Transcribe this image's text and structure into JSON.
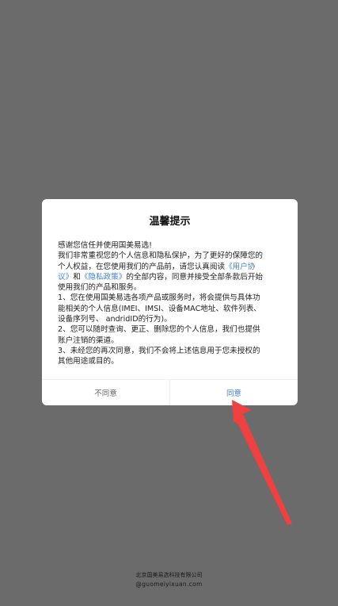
{
  "dialog": {
    "title": "温馨提示",
    "body": {
      "l1": "感谢您信任并使用国美易选!",
      "l2": "我们非常重视您的个人信息和隐私保护，为了更好的保障您的",
      "l3a": "个人权益，在您使用我们的产品前，请您认真阅读",
      "l3link": "《用户协",
      "l4link1": "议》",
      "l4b": "和",
      "l4link2": "《隐私政策》",
      "l4c": "的全部内容，同意并接受全部条款后开始",
      "l5": "使用我们的产品和服务。",
      "l6": "1、您在使用国美易选各项产品或服务时，将会提供与具体功",
      "l7": "能相关的个人信息(IMEI、IMSI、设备MAC地址、软件列表、",
      "l8": "设备序列号、 andridID的行为)。",
      "l9": "2、您可以随时查询、更正、删除您的个人信息，我们也提供",
      "l10": "账户注销的渠道。",
      "l11": "3、未经您的再次同意，我们不会将上述信息用于您未授权的",
      "l12": "其他用途或目的。"
    },
    "decline_label": "不同意",
    "accept_label": "同意",
    "link_color": "#3f7fd6"
  },
  "annotation": {
    "arrow_color": "#f04040"
  },
  "footer": {
    "company": "北京国美易选科技有限公司",
    "site": "guomeiyixuan.com",
    "site_prefix": "@"
  }
}
